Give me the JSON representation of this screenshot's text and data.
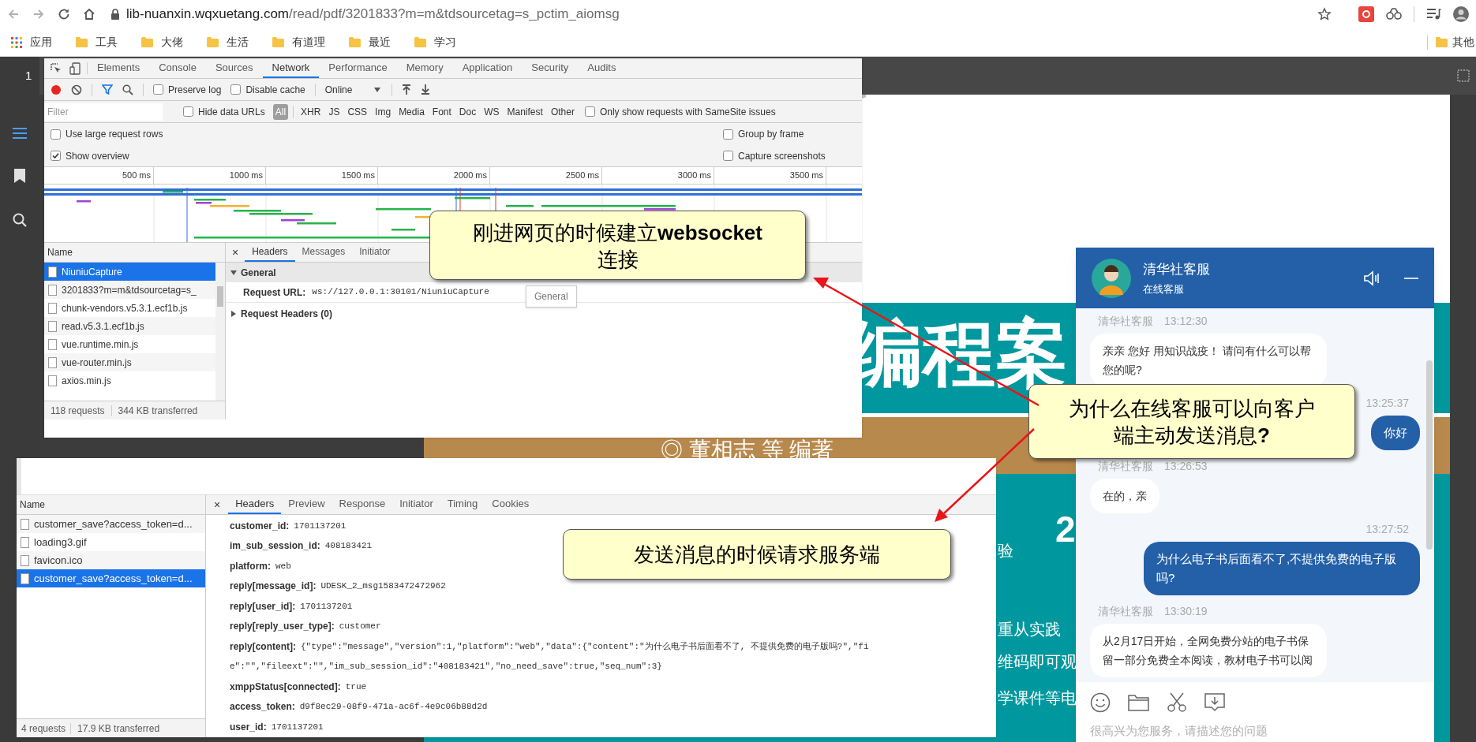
{
  "browser": {
    "url_host": "lib-nuanxin.wqxuetang.com",
    "url_path": "/read/pdf/3201833?m=m&tdsourcetag=s_pctim_aiomsg",
    "bookmarks": [
      {
        "kind": "apps",
        "label": "应用"
      },
      {
        "kind": "folder",
        "label": "工具"
      },
      {
        "kind": "folder",
        "label": "大佬"
      },
      {
        "kind": "folder",
        "label": "生活"
      },
      {
        "kind": "folder",
        "label": "有道理"
      },
      {
        "kind": "folder",
        "label": "最近"
      },
      {
        "kind": "folder",
        "label": "学习"
      }
    ],
    "other_bookmarks": "其他"
  },
  "pdf_viewer": {
    "page_number": "1",
    "title": "编程案",
    "authors": "◎ 董相志 等 编著",
    "number": "2",
    "snippets": [
      "验",
      "重从实践",
      "维码即可观",
      "学课件等电"
    ]
  },
  "devtools_top": {
    "tabs": [
      {
        "label": "Elements",
        "selected": false
      },
      {
        "label": "Console",
        "selected": false
      },
      {
        "label": "Sources",
        "selected": false
      },
      {
        "label": "Network",
        "selected": true
      },
      {
        "label": "Performance",
        "selected": false
      },
      {
        "label": "Memory",
        "selected": false
      },
      {
        "label": "Application",
        "selected": false
      },
      {
        "label": "Security",
        "selected": false
      },
      {
        "label": "Audits",
        "selected": false
      }
    ],
    "toolbar_checks": [
      {
        "label": "Preserve log",
        "checked": false
      },
      {
        "label": "Disable cache",
        "checked": false
      }
    ],
    "throttling": "Online",
    "filter_placeholder": "Filter",
    "hide_data_urls": {
      "label": "Hide data URLs",
      "checked": false
    },
    "filter_types": [
      {
        "label": "All",
        "selected": true
      },
      {
        "label": "XHR",
        "selected": false
      },
      {
        "label": "JS",
        "selected": false
      },
      {
        "label": "CSS",
        "selected": false
      },
      {
        "label": "Img",
        "selected": false
      },
      {
        "label": "Media",
        "selected": false
      },
      {
        "label": "Font",
        "selected": false
      },
      {
        "label": "Doc",
        "selected": false
      },
      {
        "label": "WS",
        "selected": false
      },
      {
        "label": "Manifest",
        "selected": false
      },
      {
        "label": "Other",
        "selected": false
      }
    ],
    "samesite": {
      "label": "Only show requests with SameSite issues",
      "checked": false
    },
    "options_left": [
      {
        "label": "Use large request rows",
        "checked": false
      },
      {
        "label": "Show overview",
        "checked": true
      }
    ],
    "options_right": [
      {
        "label": "Group by frame",
        "checked": false
      },
      {
        "label": "Capture screenshots",
        "checked": false
      }
    ],
    "ruler": [
      "500 ms",
      "1000 ms",
      "1500 ms",
      "2000 ms",
      "2500 ms",
      "3000 ms",
      "3500 ms"
    ],
    "name_header": "Name",
    "requests": [
      {
        "name": "NiuniuCapture",
        "selected": true
      },
      {
        "name": "3201833?m=m&tdsourcetag=s_",
        "selected": false
      },
      {
        "name": "chunk-vendors.v5.3.1.ecf1b.js",
        "selected": false
      },
      {
        "name": "read.v5.3.1.ecf1b.js",
        "selected": false
      },
      {
        "name": "vue.runtime.min.js",
        "selected": false
      },
      {
        "name": "vue-router.min.js",
        "selected": false
      },
      {
        "name": "axios.min.js",
        "selected": false
      }
    ],
    "footer": [
      "118 requests",
      "344 KB transferred"
    ],
    "close": "×",
    "detail_tabs": [
      {
        "label": "Headers",
        "selected": true
      },
      {
        "label": "Messages",
        "selected": false
      },
      {
        "label": "Initiator",
        "selected": false
      }
    ],
    "general": {
      "title": "General",
      "expanded": true,
      "url_label": "Request URL:",
      "url": "ws://127.0.0.1:30101/NiuniuCapture"
    },
    "request_headers": {
      "title": "Request Headers (0)",
      "expanded": false
    },
    "tooltip": "General"
  },
  "devtools_bottom": {
    "name_header": "Name",
    "requests": [
      {
        "name": "customer_save?access_token=d...",
        "selected": false
      },
      {
        "name": "loading3.gif",
        "selected": false
      },
      {
        "name": "favicon.ico",
        "selected": false
      },
      {
        "name": "customer_save?access_token=d...",
        "selected": true
      }
    ],
    "footer": [
      "4 requests",
      "17.9 KB transferred"
    ],
    "close": "×",
    "detail_tabs": [
      {
        "label": "Headers",
        "selected": true
      },
      {
        "label": "Preview",
        "selected": false
      },
      {
        "label": "Response",
        "selected": false
      },
      {
        "label": "Initiator",
        "selected": false
      },
      {
        "label": "Timing",
        "selected": false
      },
      {
        "label": "Cookies",
        "selected": false
      }
    ],
    "form_rows": [
      {
        "key": "customer_id:",
        "value_lines": [
          "1701137201"
        ]
      },
      {
        "key": "im_sub_session_id:",
        "value_lines": [
          "408183421"
        ]
      },
      {
        "key": "platform:",
        "value_lines": [
          "web"
        ]
      },
      {
        "key": "reply[message_id]:",
        "value_lines": [
          "UDESK_2_msg1583472472962"
        ]
      },
      {
        "key": "reply[user_id]:",
        "value_lines": [
          "1701137201"
        ]
      },
      {
        "key": "reply[reply_user_type]:",
        "value_lines": [
          "customer"
        ]
      },
      {
        "key": "reply[content]:",
        "value_lines": [
          "{\"type\":\"message\",\"version\":1,\"platform\":\"web\",\"data\":{\"content\":\"为什么电子书后面看不了, 不提供免费的电子版吗?\",\"fi",
          "e\":\"\",\"fileext\":\"\",\"im_sub_session_id\":\"408183421\",\"no_need_save\":true,\"seq_num\":3}"
        ]
      },
      {
        "key": "xmppStatus[connected]:",
        "value_lines": [
          "true"
        ]
      },
      {
        "key": "access_token:",
        "value_lines": [
          "d9f8ec29-08f9-471a-ac6f-4e9c06b88d2d"
        ]
      },
      {
        "key": "user_id:",
        "value_lines": [
          "1701137201"
        ]
      }
    ]
  },
  "chat": {
    "title": "清华社客服",
    "subtitle": "在线客服",
    "messages": [
      {
        "kind": "agent",
        "sender": "清华社客服",
        "time": "13:12:30",
        "text": "亲亲 您好 用知识战疫！ 请问有什么可以帮您的呢?"
      },
      {
        "kind": "user",
        "time": "13:25:37",
        "text": "你好"
      },
      {
        "kind": "agent",
        "sender": "清华社客服",
        "time": "13:26:53",
        "text": "在的，亲"
      },
      {
        "kind": "user",
        "time": "13:27:52",
        "text": "为什么电子书后面看不了,不提供免费的电子版吗?"
      },
      {
        "kind": "agent",
        "sender": "清华社客服",
        "time": "13:30:19",
        "text": "从2月17日开始，全网免费分站的电子书保留一部分免费全本阅读，教材电子书可以阅"
      }
    ],
    "input_placeholder": "很高兴为您服务，请描述您的问题"
  },
  "callouts": [
    {
      "lines": [
        "刚进网页的时候建立**websocket**",
        "连接"
      ]
    },
    {
      "lines": [
        "为什么在线客服可以向客户",
        "端主动发送消息**?**"
      ]
    },
    {
      "lines": [
        "发送消息的时候请求服务端"
      ]
    }
  ]
}
